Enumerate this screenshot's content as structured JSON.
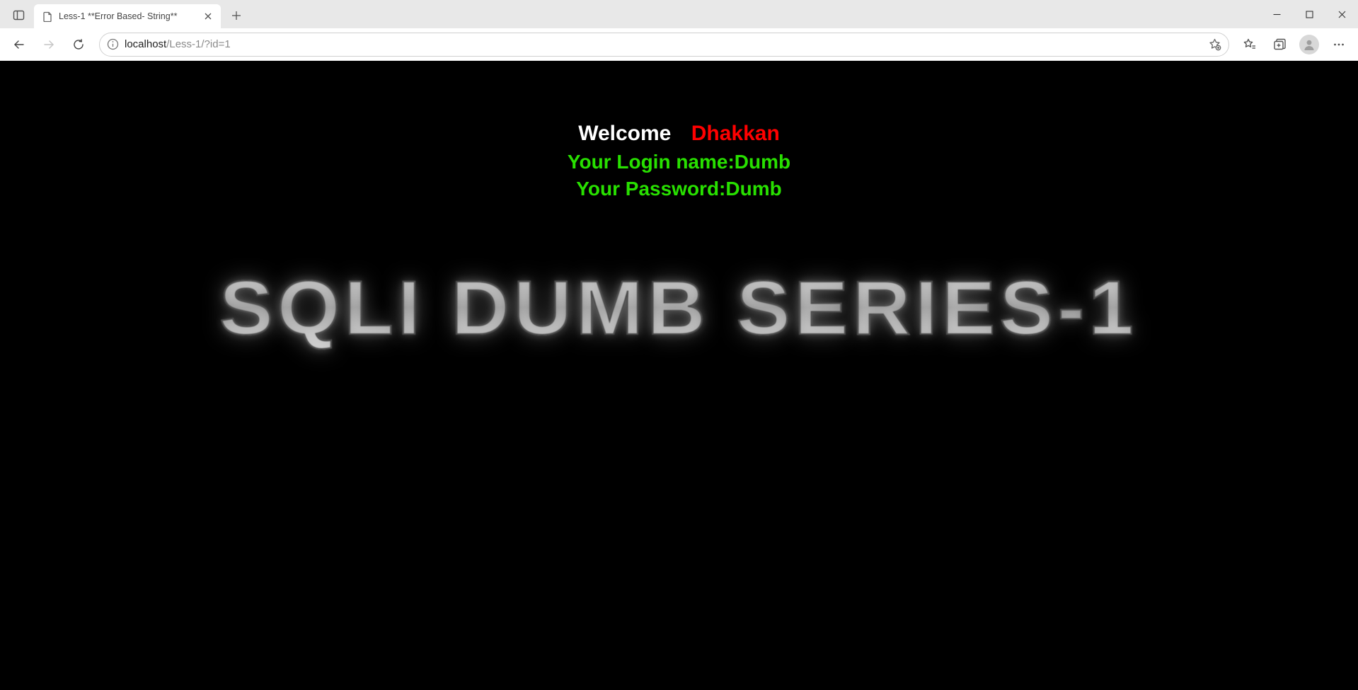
{
  "browser": {
    "tab_title": "Less-1 **Error Based- String**",
    "url_host": "localhost",
    "url_path": "/Less-1/?id=1"
  },
  "page": {
    "welcome_label": "Welcome",
    "welcome_name": "Dhakkan",
    "login_line": "Your Login name:Dumb",
    "password_line": "Your Password:Dumb",
    "hero_title": "SQLI DUMB SERIES-1"
  }
}
